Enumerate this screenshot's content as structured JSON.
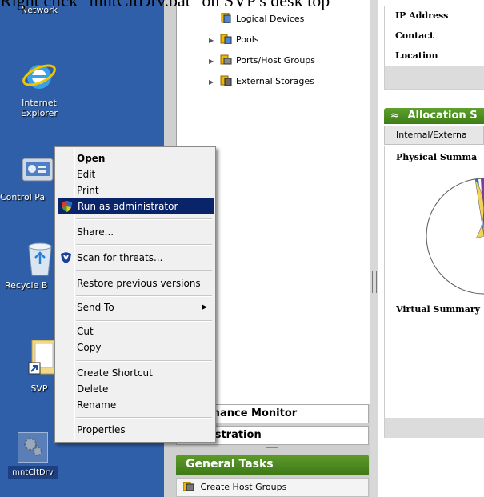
{
  "caption": "Right click \"mntCltDrv.bat\" on SVP's desk top",
  "desktop": {
    "icons": [
      {
        "label": "Network"
      },
      {
        "label_lines": [
          "Internet",
          "Explorer"
        ]
      },
      {
        "label": "Control Pa"
      },
      {
        "label": "Recycle B"
      },
      {
        "label": "SVP"
      },
      {
        "label": "mntCltDrv"
      }
    ]
  },
  "tree": {
    "items": [
      {
        "label": "Logical Devices"
      },
      {
        "label": "Pools"
      },
      {
        "label": "Ports/Host Groups"
      },
      {
        "label": "External Storages"
      }
    ]
  },
  "accordion": {
    "performance_monitor": "rmance Monitor",
    "administration": "nistration"
  },
  "general_tasks": {
    "title": "General Tasks",
    "task1": "Create Host Groups"
  },
  "properties": {
    "ip_address": "IP Address",
    "contact": "Contact",
    "location": "Location"
  },
  "allocation": {
    "title": "Allocation S",
    "tab": "Internal/Externa",
    "physical_summary": "Physical Summa",
    "virtual_summary": "Virtual Summary"
  },
  "context_menu": {
    "items": [
      {
        "label": "Open",
        "bold": true
      },
      {
        "label": "Edit"
      },
      {
        "label": "Print"
      },
      {
        "label": "Run as administrator",
        "highlighted": true,
        "icon": "uac-shield-icon"
      },
      {
        "label": "Share..."
      },
      {
        "label": "Scan for threats...",
        "icon": "antivirus-shield-icon"
      },
      {
        "label": "Restore previous versions"
      },
      {
        "label": "Send To",
        "submenu": true
      },
      {
        "label": "Cut"
      },
      {
        "label": "Copy"
      },
      {
        "label": "Create Shortcut"
      },
      {
        "label": "Delete"
      },
      {
        "label": "Rename"
      },
      {
        "label": "Properties"
      }
    ]
  },
  "colors": {
    "desktop": "#2f5fa8",
    "menu_highlight": "#0a246a",
    "task_header_green": "#4a8a1e"
  }
}
